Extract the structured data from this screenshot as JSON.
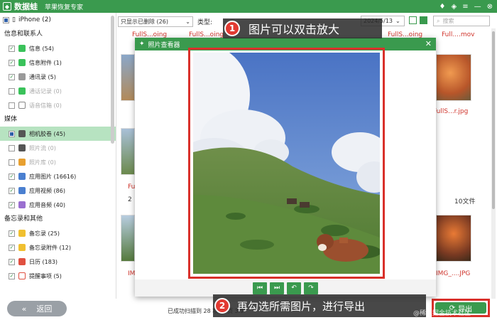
{
  "app": {
    "name": "数据蛙",
    "subtitle": "苹果恢复专家"
  },
  "sidebar": {
    "device": "iPhone (2)",
    "sections": [
      {
        "title": "信息和联系人",
        "items": [
          {
            "label": "信息 (54)",
            "state": "checked",
            "icon_color": "#3ac25a"
          },
          {
            "label": "信息附件 (1)",
            "state": "checked",
            "icon_color": "#3ac25a"
          },
          {
            "label": "通讯录 (5)",
            "state": "checked",
            "icon_color": "#9a9a9a"
          },
          {
            "label": "通话记录 (0)",
            "state": "empty",
            "disabled": true,
            "icon_color": "#3ac25a"
          },
          {
            "label": "语音信箱 (0)",
            "state": "empty",
            "disabled": true,
            "icon_color": "#888"
          }
        ]
      },
      {
        "title": "媒体",
        "items": [
          {
            "label": "相机胶卷 (45)",
            "state": "part",
            "active": true,
            "icon_color": "#555"
          },
          {
            "label": "照片流 (0)",
            "state": "empty",
            "disabled": true,
            "icon_color": "#555"
          },
          {
            "label": "照片库 (0)",
            "state": "empty",
            "disabled": true,
            "icon_color": "#e8a030"
          },
          {
            "label": "应用图片 (16616)",
            "state": "checked",
            "icon_color": "#4a7fd0"
          },
          {
            "label": "应用视频 (86)",
            "state": "checked",
            "icon_color": "#4a7fd0"
          },
          {
            "label": "应用音频 (40)",
            "state": "checked",
            "icon_color": "#9a6fd0"
          }
        ]
      },
      {
        "title": "备忘录和其他",
        "items": [
          {
            "label": "备忘录 (25)",
            "state": "checked",
            "icon_color": "#f0c030"
          },
          {
            "label": "备忘录附件 (12)",
            "state": "checked",
            "icon_color": "#f0c030"
          },
          {
            "label": "日历 (183)",
            "state": "checked",
            "icon_color": "#e05040"
          },
          {
            "label": "提醒事项 (5)",
            "state": "checked",
            "icon_color": "#e05040"
          }
        ]
      }
    ],
    "back_label": "返回"
  },
  "toolbar": {
    "filter": "只显示已删除 (26)",
    "type_label": "类型:",
    "date": "2024/5/13",
    "search_placeholder": "搜索"
  },
  "grid": {
    "file_labels": [
      "FullS...oing",
      "FullS...oing",
      "FullS...oing",
      "Full....mov",
      "FullS...r.jpg",
      "Full",
      "IMG_....JPG",
      "IM"
    ],
    "file_count": "10文件",
    "row_count": "2"
  },
  "viewer": {
    "title": "照片查看器",
    "controls": [
      "⏮",
      "⏭",
      "↶",
      "↷"
    ]
  },
  "status": {
    "text": "已成功扫描到 28 项 ... 页 3.9"
  },
  "export_label": "导出",
  "annotations": [
    {
      "num": "1",
      "text": "图片可以双击放大"
    },
    {
      "num": "2",
      "text": "再勾选所需图片，进行导出"
    }
  ],
  "watermark": "@稀土掘金技术社区",
  "colors": {
    "brand_green": "#3a9a4e",
    "highlight_red": "#d9302a"
  }
}
